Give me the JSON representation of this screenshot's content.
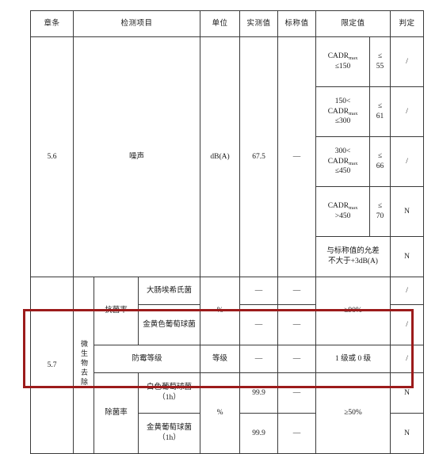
{
  "table": {
    "headers": {
      "clause": "章条",
      "item": "检测项目",
      "unit": "单位",
      "measured": "实测值",
      "nominal": "标称值",
      "limit": "限定值",
      "judgment": "判定"
    },
    "noise_section": {
      "clause": "5.6",
      "item": "噪声",
      "unit": "dB(A)",
      "measured": "67.5",
      "nominal": "—",
      "limits": [
        {
          "condition": "CADR",
          "condition_sub": "max",
          "condition_line2": "≤150",
          "value": "≤",
          "value2": "55",
          "judgment": "/"
        },
        {
          "condition_line0": "150<",
          "condition": "CADR",
          "condition_sub": "max",
          "condition_line2": "≤300",
          "value": "≤",
          "value2": "61",
          "judgment": "/"
        },
        {
          "condition_line0": "300<",
          "condition": "CADR",
          "condition_sub": "max",
          "condition_line2": "≤450",
          "value": "≤",
          "value2": "66",
          "judgment": "/"
        },
        {
          "condition": "CADR",
          "condition_sub": "max",
          "condition_line2": ">450",
          "value": "≤",
          "value2": "70",
          "judgment": "N"
        },
        {
          "text_line1": "与标称值的允差",
          "text_line2": "不大于+3dB(A)",
          "judgment": "N"
        }
      ]
    },
    "micro_section": {
      "group_label": "微生物去除",
      "antibacterial": {
        "label": "抗菌率",
        "unit": "%",
        "limit": "≥90%",
        "rows": [
          {
            "name": "大肠埃希氏菌",
            "measured": "—",
            "nominal": "—",
            "judgment": "/"
          },
          {
            "name": "金黄色葡萄球菌",
            "measured": "—",
            "nominal": "—",
            "judgment": "/"
          }
        ]
      },
      "mold": {
        "name": "防霉等级",
        "unit": "等级",
        "measured": "—",
        "nominal": "—",
        "limit": "1 级或 0 级",
        "judgment": "/"
      },
      "sterilization": {
        "clause": "5.7",
        "label": "除菌率",
        "unit": "%",
        "limit": "≥50%",
        "rows": [
          {
            "name_line1": "白色葡萄球菌",
            "name_line2": "（1h）",
            "measured": "99.9",
            "nominal": "—",
            "judgment": "N"
          },
          {
            "name_line1": "金黄葡萄球菌",
            "name_line2": "（1h）",
            "measured": "99.9",
            "nominal": "—",
            "judgment": "N"
          }
        ]
      }
    }
  },
  "annotation": {
    "highlight_color": "#9c1b1b"
  }
}
